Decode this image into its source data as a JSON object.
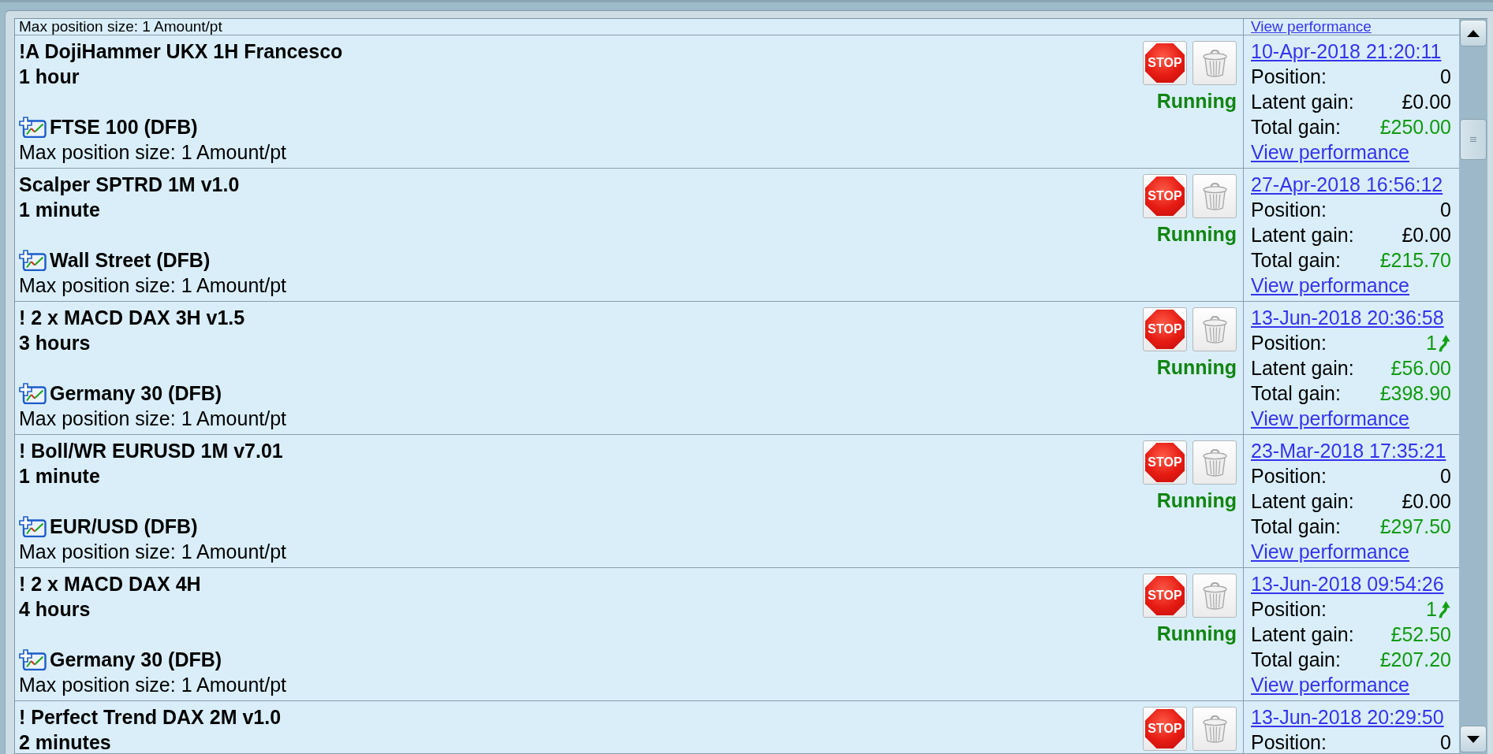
{
  "list_top_partial": {
    "max_position": "Max position size: 1 Amount/pt",
    "performance_link": "View performance"
  },
  "strategies": [
    {
      "name": "!A DojiHammer UKX 1H Francesco",
      "period": "1 hour",
      "market": "FTSE 100 (DFB)",
      "max_position": "Max position size: 1 Amount/pt",
      "stop_label": "STOP",
      "delete_disabled": true,
      "status": {
        "kind": "running",
        "text": "Running"
      },
      "started": "10-Apr-2018 21:20:11",
      "stats": [
        {
          "label": "Position:",
          "value": "0",
          "color": "#000000",
          "arrow_up": false
        },
        {
          "label": "Latent gain:",
          "value": "£0.00",
          "color": "#000000"
        },
        {
          "label": "Total gain:",
          "value": "£250.00",
          "color": "#109a10"
        }
      ],
      "performance_link": "View performance"
    },
    {
      "name": "Scalper SPTRD 1M v1.0",
      "period": "1 minute",
      "market": "Wall Street (DFB)",
      "max_position": "Max position size: 1 Amount/pt",
      "stop_label": "STOP",
      "delete_disabled": true,
      "status": {
        "kind": "running",
        "text": "Running"
      },
      "started": "27-Apr-2018 16:56:12",
      "stats": [
        {
          "label": "Position:",
          "value": "0",
          "color": "#000000",
          "arrow_up": false
        },
        {
          "label": "Latent gain:",
          "value": "£0.00",
          "color": "#000000"
        },
        {
          "label": "Total gain:",
          "value": "£215.70",
          "color": "#109a10"
        }
      ],
      "performance_link": "View performance"
    },
    {
      "name": "! 2 x MACD DAX 3H v1.5",
      "period": "3 hours",
      "market": "Germany 30 (DFB)",
      "max_position": "Max position size: 1 Amount/pt",
      "stop_label": "STOP",
      "delete_disabled": true,
      "status": {
        "kind": "running",
        "text": "Running"
      },
      "started": "13-Jun-2018 20:36:58",
      "stats": [
        {
          "label": "Position:",
          "value": "1",
          "color": "#109a10",
          "arrow_up": true
        },
        {
          "label": "Latent gain:",
          "value": "£56.00",
          "color": "#109a10"
        },
        {
          "label": "Total gain:",
          "value": "£398.90",
          "color": "#109a10"
        }
      ],
      "performance_link": "View performance"
    },
    {
      "name": "! Boll/WR EURUSD 1M v7.01",
      "period": "1 minute",
      "market": "EUR/USD (DFB)",
      "max_position": "Max position size: 1 Amount/pt",
      "stop_label": "STOP",
      "delete_disabled": true,
      "status": {
        "kind": "running",
        "text": "Running"
      },
      "started": "23-Mar-2018 17:35:21",
      "stats": [
        {
          "label": "Position:",
          "value": "0",
          "color": "#000000",
          "arrow_up": false
        },
        {
          "label": "Latent gain:",
          "value": "£0.00",
          "color": "#000000"
        },
        {
          "label": "Total gain:",
          "value": "£297.50",
          "color": "#109a10"
        }
      ],
      "performance_link": "View performance"
    },
    {
      "name": "! 2 x MACD DAX 4H",
      "period": "4 hours",
      "market": "Germany 30 (DFB)",
      "max_position": "Max position size: 1 Amount/pt",
      "stop_label": "STOP",
      "delete_disabled": true,
      "status": {
        "kind": "running",
        "text": "Running"
      },
      "started": "13-Jun-2018 09:54:26",
      "stats": [
        {
          "label": "Position:",
          "value": "1",
          "color": "#109a10",
          "arrow_up": true
        },
        {
          "label": "Latent gain:",
          "value": "£52.50",
          "color": "#109a10"
        },
        {
          "label": "Total gain:",
          "value": "£207.20",
          "color": "#109a10"
        }
      ],
      "performance_link": "View performance"
    },
    {
      "name": "! Perfect Trend DAX 2M v1.0",
      "period": "2 minutes",
      "stop_label": "STOP",
      "delete_disabled": true,
      "started": "13-Jun-2018 20:29:50",
      "stats": [
        {
          "label": "Position:",
          "value": "0",
          "color": "#000000",
          "arrow_up": false
        }
      ]
    }
  ]
}
